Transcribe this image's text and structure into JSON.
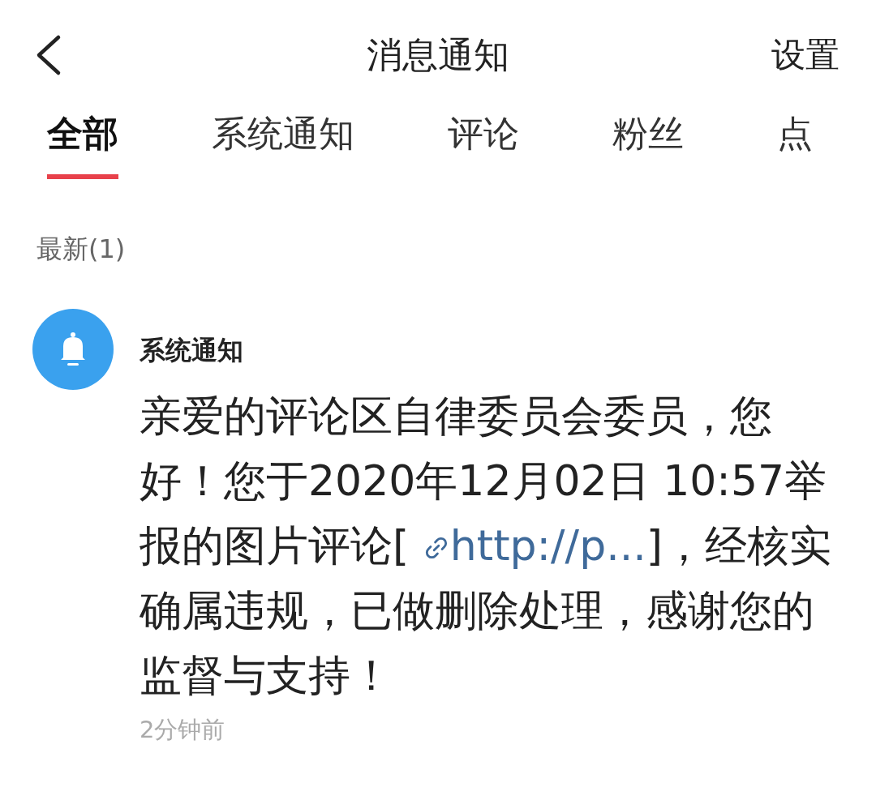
{
  "header": {
    "title": "消息通知",
    "action": "设置"
  },
  "tabs": [
    {
      "label": "全部",
      "selected": true
    },
    {
      "label": "系统通知",
      "selected": false
    },
    {
      "label": "评论",
      "selected": false
    },
    {
      "label": "粉丝",
      "selected": false
    },
    {
      "label": "点",
      "selected": false
    }
  ],
  "section": {
    "label": "最新(1)"
  },
  "notifications": [
    {
      "title": "系统通知",
      "body_before": "亲爱的评论区自律委员会委员，您好！您于2020年12月02日 10:57举报的图片评论[ ",
      "link": "http://p...",
      "body_after": "]，经核实确属违规，已做删除处理，感谢您的监督与支持！",
      "time": "2分钟前"
    }
  ]
}
